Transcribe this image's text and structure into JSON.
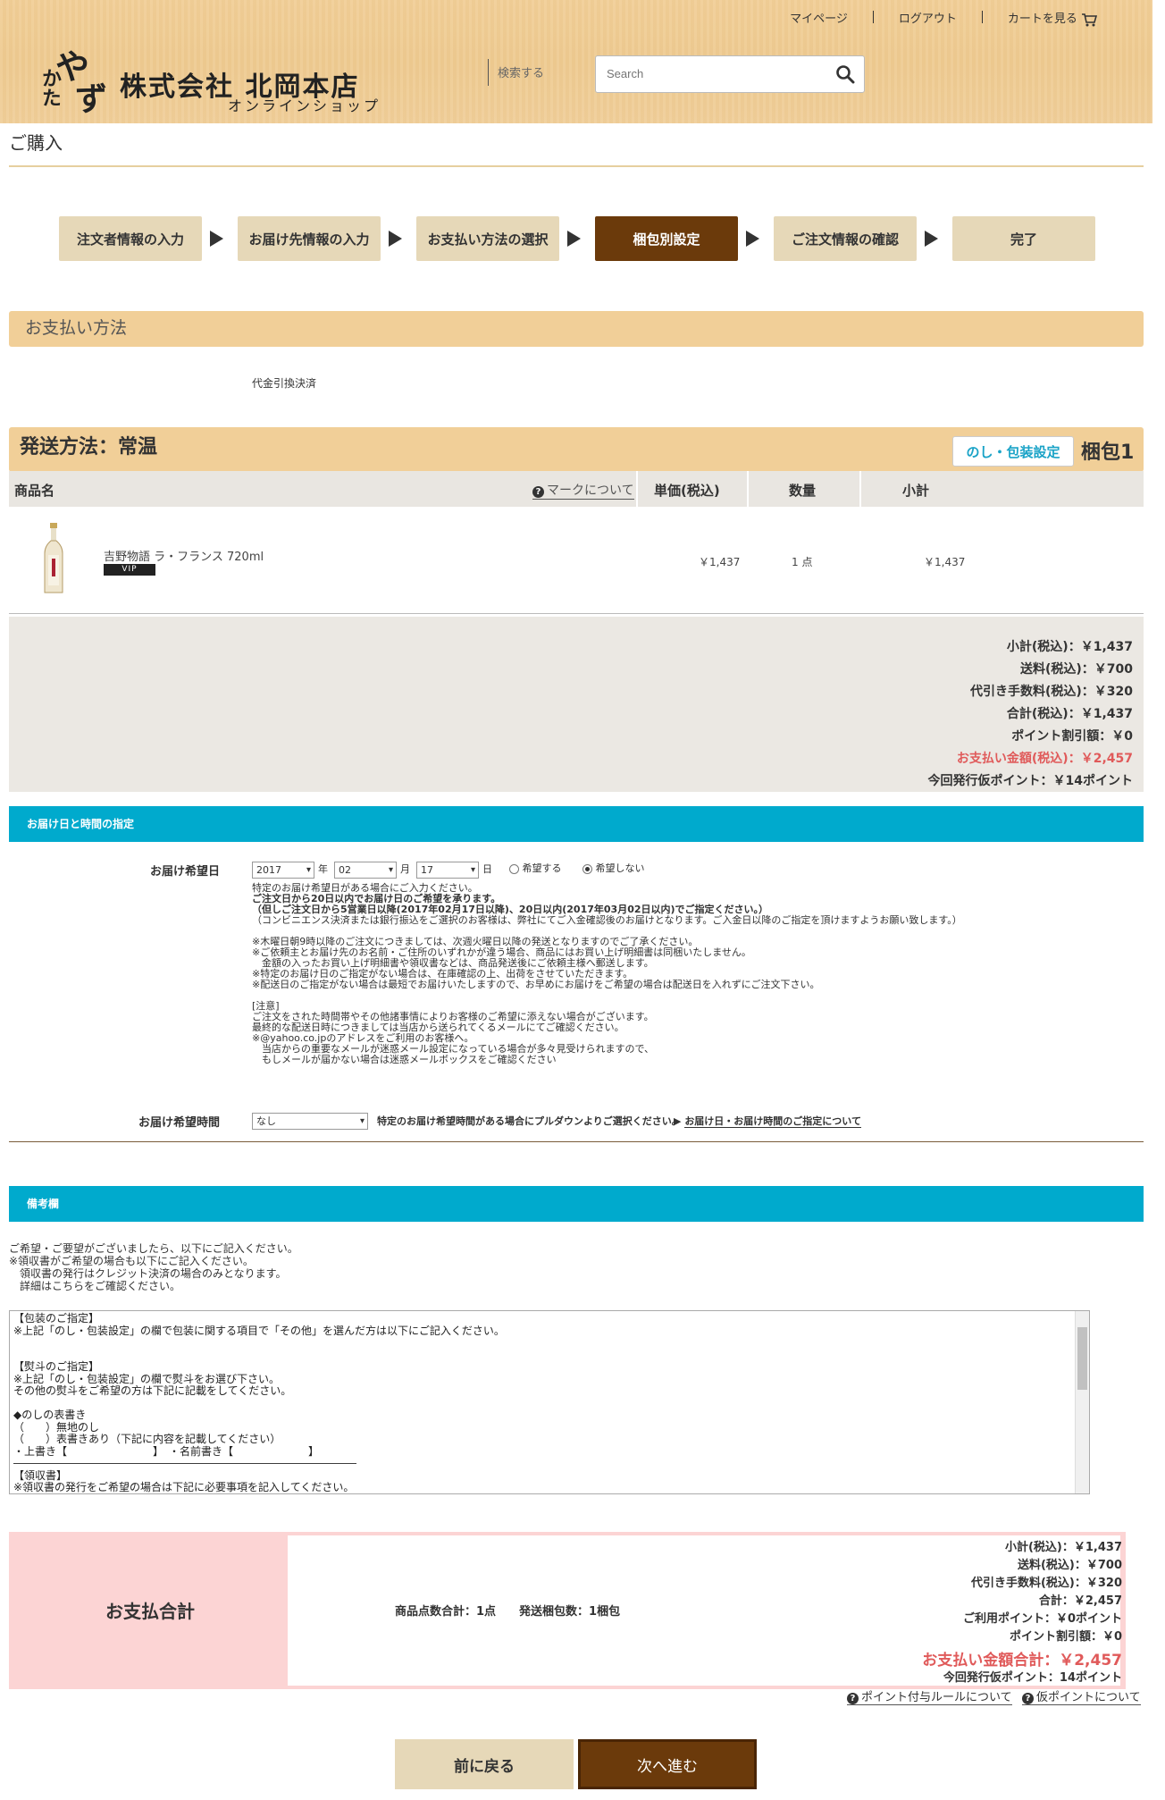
{
  "header": {
    "links": [
      "マイページ",
      "ログアウト",
      "カートを見る"
    ],
    "logo_mark": [
      "や",
      "かた",
      "ず"
    ],
    "company": "株式会社 北岡本店",
    "shop": "オンラインショップ",
    "search_label": "検索する",
    "search_placeholder": "Search"
  },
  "page_title": "ご購入",
  "steps": [
    "注文者情報の入力",
    "お届け先情報の入力",
    "お支払い方法の選択",
    "梱包別設定",
    "ご注文情報の確認",
    "完了"
  ],
  "active_step": 3,
  "payment": {
    "title": "お支払い方法",
    "value": "代金引換決済"
  },
  "shipping": {
    "title": "発送方法：常温",
    "noshi_button": "のし・包装設定",
    "package": "梱包1",
    "columns": [
      "商品名",
      "マークについて",
      "単価(税込)",
      "数量",
      "小計"
    ],
    "item": {
      "name": "吉野物語 ラ・フランス 720ml",
      "badge": "VIP",
      "price": "￥1,437",
      "qty": "1 点",
      "subtotal": "￥1,437"
    },
    "summary": [
      "小計(税込)：￥1,437",
      "送料(税込)：￥700",
      "代引き手数料(税込)：￥320",
      "合計(税込)：￥1,437",
      "ポイント割引額：￥0",
      "お支払い金額(税込)：￥2,457",
      "今回発行仮ポイント：￥14ポイント"
    ]
  },
  "delivery": {
    "bar_title": "お届け日と時間の指定",
    "date_label": "お届け希望日",
    "year": "2017",
    "year_unit": "年",
    "month": "02",
    "month_unit": "月",
    "day": "17",
    "day_unit": "日",
    "radio_yes": "希望する",
    "radio_no": "希望しない",
    "radio_selected": "希望しない",
    "notes": [
      "特定のお届け希望日がある場合にご入力ください。",
      "ご注文日から20日以内でお届け日のご希望を承ります。",
      "（但しご注文日から5営業日以降(2017年02月17日以降)、20日以内(2017年03月02日以内)でご指定ください。）",
      "（コンビニエンス決済または銀行振込をご選択のお客様は、弊社にてご入金確認後のお届けとなります。ご入金日以降のご指定を頂けますようお願い致します。）",
      "",
      "※木曜日朝9時以降のご注文につきましては、次週火曜日以降の発送となりますのでご了承ください。",
      "※ご依頼主とお届け先のお名前・ご住所のいずれかが違う場合、商品にはお買い上げ明細書は同梱いたしません。",
      "　金額の入ったお買い上げ明細書や領収書などは、商品発送後にご依頼主様へ郵送します。",
      "※特定のお届け日のご指定がない場合は、在庫確認の上、出荷をさせていただきます。",
      "※配送日のご指定がない場合は最短でお届けいたしますので、お早めにお届けをご希望の場合は配送日を入れずにご注文下さい。",
      "",
      "[注意]",
      "ご注文をされた時間帯やその他諸事情によりお客様のご希望に添えない場合がございます。",
      "最終的な配送日時につきましては当店から送られてくるメールにてご確認ください。",
      "※@yahoo.co.jpのアドレスをご利用のお客様へ。",
      "　当店からの重要なメールが迷惑メール設定になっている場合が多々見受けられますので、",
      "　もしメールが届かない場合は迷惑メールボックスをご確認ください"
    ],
    "time_label": "お届け希望時間",
    "time_value": "なし",
    "time_note": "特定のお届け希望時間がある場合にプルダウンよりご選択ください。",
    "time_link": "お届け日・お届け時間のご指定について"
  },
  "remarks": {
    "bar_title": "備考欄",
    "intro": [
      "ご希望・ご要望がございましたら、以下にご記入ください。",
      "※領収書がご希望の場合も以下にご記入ください。",
      "　領収書の発行はクレジット決済の場合のみとなります。",
      "　詳細はこちらをご確認ください。"
    ],
    "textarea": "【包装のご指定】\n※上記「のし・包装設定」の欄で包装に関する項目で「その他」を選んだ方は以下にご記入ください。\n\n\n【熨斗のご指定】\n※上記「のし・包装設定」の欄で熨斗をお選び下さい。\nその他の熨斗をご希望の方は下記に記載をしてください。\n\n◆のしの表書き\n（　　）無地のし\n（　　）表書きあり（下記に内容を記載してください）\n・上書き【　　　　　　　　】　・名前書き【　　　　　　　】\n――――――――――――――――――――――――――――――――\n【領収書】\n※領収書の発行をご希望の場合は下記に必要事項を記入してください。"
  },
  "total": {
    "title": "お支払合計",
    "counts": "商品点数合計：1点　　発送梱包数：1梱包",
    "lines": [
      "小計(税込)：￥1,437",
      "送料(税込)：￥700",
      "代引き手数料(税込)：￥320",
      "合計：￥2,457",
      "ご利用ポイント：￥0ポイント",
      "ポイント割引額：￥0"
    ],
    "pay_amount": "お支払い金額合計：￥2,457",
    "points": "今回発行仮ポイント：14ポイント"
  },
  "help_links": [
    "ポイント付与ルールについて",
    "仮ポイントについて"
  ],
  "buttons": {
    "back": "前に戻る",
    "next": "次へ進む"
  },
  "colors": {
    "header_tan": "#f1cf98",
    "brown": "#6b3a0b",
    "cyan": "#00aacd",
    "step_beige": "#e6d8b8",
    "red": "#e05a5a",
    "pink": "#fcd4d4"
  }
}
